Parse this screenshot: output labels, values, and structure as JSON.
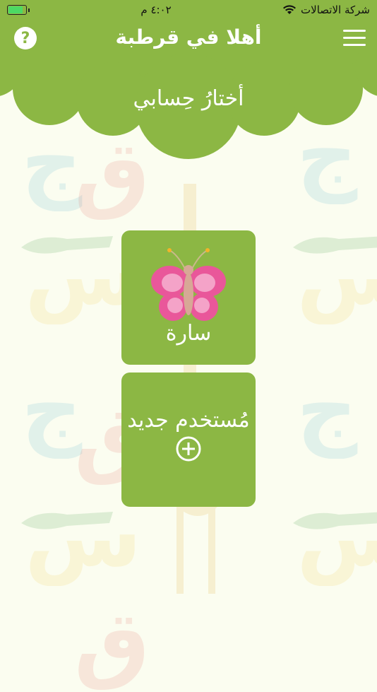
{
  "status_bar": {
    "carrier": "شركة الاتصالات",
    "time": "٤:٠٢ م"
  },
  "header": {
    "title": "أهلا في قرطبة",
    "subtitle": "أختارُ حِسابي",
    "help_icon": "?"
  },
  "accounts": [
    {
      "name": "سارة",
      "icon": "butterfly-icon"
    }
  ],
  "new_user": {
    "label": "مُستخدم جديد",
    "icon": "plus-circle-icon"
  },
  "colors": {
    "accent": "#8cb744",
    "background": "#fbfdf0"
  }
}
